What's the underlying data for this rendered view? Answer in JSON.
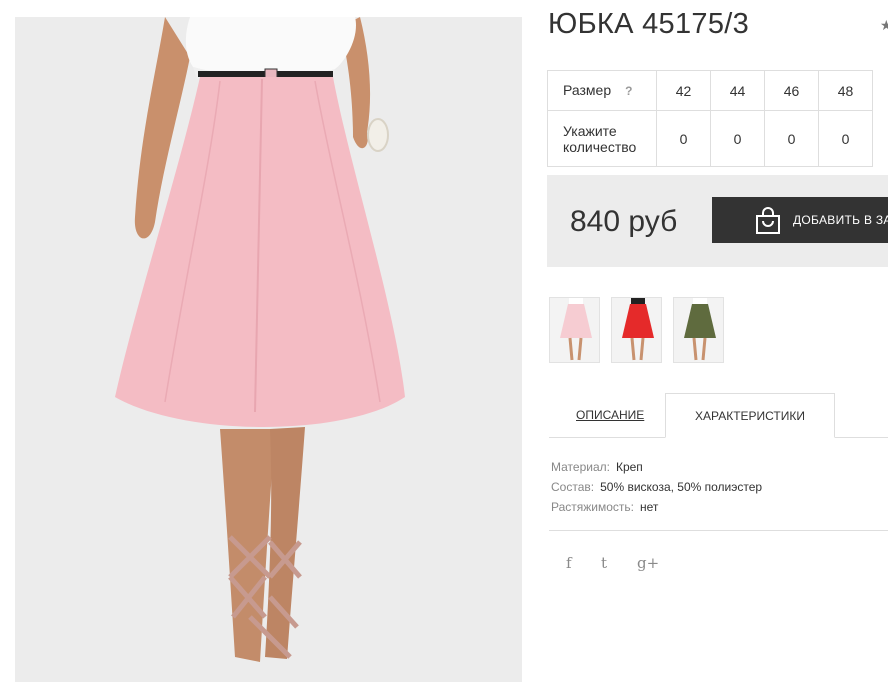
{
  "product": {
    "title": "ЮБКА 45175/3",
    "favorite_icon": "★"
  },
  "size_table": {
    "size_label": "Размер",
    "help_mark": "?",
    "sizes": [
      "42",
      "44",
      "46",
      "48"
    ],
    "qty_label_line1": "Укажите",
    "qty_label_line2": "количество",
    "quantities": [
      "0",
      "0",
      "0",
      "0"
    ]
  },
  "purchase": {
    "price": "840 руб",
    "add_to_cart_label": "ДОБАВИТЬ В ЗА",
    "bag_icon": "shopping-bag-icon"
  },
  "thumbnails": [
    {
      "color": "#f4c6cc",
      "alt": "pink"
    },
    {
      "color": "#e52a2a",
      "alt": "red"
    },
    {
      "color": "#5f6b3e",
      "alt": "olive"
    }
  ],
  "tabs": {
    "description": "ОПИСАНИЕ",
    "characteristics": "ХАРАКТЕРИСТИКИ"
  },
  "specs": [
    {
      "key": "Материал:",
      "value": "Креп"
    },
    {
      "key": "Состав:",
      "value": "50% вискоза, 50% полиэстер"
    },
    {
      "key": "Растяжимость:",
      "value": "нет"
    }
  ],
  "social": {
    "facebook": "f",
    "twitter": "t",
    "google_plus": "g+"
  },
  "colors": {
    "skirt": "#f4bcc4",
    "button": "#333333",
    "panel": "#ececec"
  }
}
